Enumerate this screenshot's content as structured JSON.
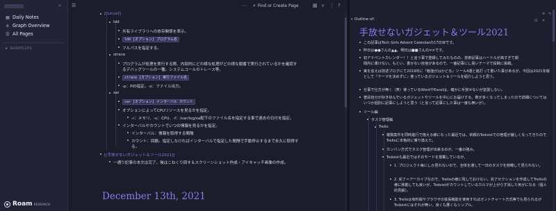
{
  "sidebar": {
    "items": [
      {
        "label": "Daily Notes",
        "icon": "calendar-icon"
      },
      {
        "label": "Graph Overview",
        "icon": "graph-icon"
      },
      {
        "label": "All Pages",
        "icon": "list-icon"
      }
    ],
    "shortcuts_label": "SHORTCUTS",
    "logo_text": "Roam",
    "logo_sub": "RESEARCH"
  },
  "topbar": {
    "search_placeholder": "Find or Create Page"
  },
  "main": {
    "lines": [
      "[[Linux]]",
      "ldd",
      "共有ライブラリへの依存関係を表示。",
      "ldd [オプション] プログラム名",
      "フルパスを指定する。",
      "strace",
      "プログラムが処理を実行する際、内部的にどの様な処理がどの様な順番で実行されているかを確認す",
      "るデバッグツールの一種。システムコールのトレース等。",
      "strace [オプション] 実行ファイル名",
      "-p：PID指定。-o：ファイル出力。",
      "sar",
      "sar [オプション] インターバル カウント",
      "オプションによってCPUリソースを見るかを指定。",
      "-r：メモリ、-u：CPU、-f：/var/log/sa配下のファイル名を指定する事で過去の日付を指定。",
      "インターバルやカウントでいつの情報を見るかを指定。",
      "インターバル：情報を取得する間隔",
      "カウント：回数。指定しなければインターバルで指定した間隔で手動停止するまで永久に取得す",
      "る。",
      "[[手放せないガジェット＆ツール2021]]",
      "一通り記事の本文は完了。後はこねくり回す＆スクリーンショット作成・アイキャッチ画像の作成。"
    ],
    "date_title": "December 13th, 2021"
  },
  "right": {
    "outline_label": "Outline of:",
    "page_title": "手放せないガジェット＆ツール2021",
    "lines": [
      "この記事はTech Girls Advent Calendarの17日目です。",
      "昨日は●●さんの▲▲。明日は■■さんの✕✕です。",
      "初アドベントカレンダー！！と言う事で登録してみたものの、技術記事はハードルが高すぎて期",
      "間内に書けない。もとい、書かない自信があるので、一番記事にし易いテーマで投稿に挑戦。",
      "実を言えば前述ブログにて2019年に『勉強がはかどる』ツール4選と銘打って書いた事があるが、今回は2021年版として『テーマを決めずに』使っているガジェット＆ツールを紹介しようと思う。",
      "仕事で仕方が無く（笑）使っているWordやExcelは、確かに手放せないが割愛しない。",
      "普段自分が好き好んでいるガジェットやツールを中心にお届けする。数が多くなってしまったので詳細についてはいつか個別に記事にしようと思う（と言って記事にした事は一度も無いが）。",
      "ツール編",
      "タスク管理編",
      "Trello",
      "複数案件を同時進行で抱える様になった最近では、依頼のTodoistでの管理が厳しくなってきたのでTrelloに本格的に乗り換えた。",
      "カンバン方式でタスク管理が出来るのが、一番の強み。",
      "Todoistも最近ではそのモードを搭載しているが、",
      "1. プロジェクト毎にしか見れないので、全体を通して一日のタスクを俯瞰して見られない。",
      "2. 完了＝アーカイブなので、Trelloの様に残しておけない。完了セクションを作成してTrelloの様に移動しても良いが、Todoistがカウントしているカルマが上がらず消した気がになる（個人的見解）。",
      "3. Trelloは有料版やブラウザの拡張機能を使用すればガントチャート方式等でも見られるがTodoistにはそれが無い。良くも悪くもシンプル。"
    ]
  }
}
